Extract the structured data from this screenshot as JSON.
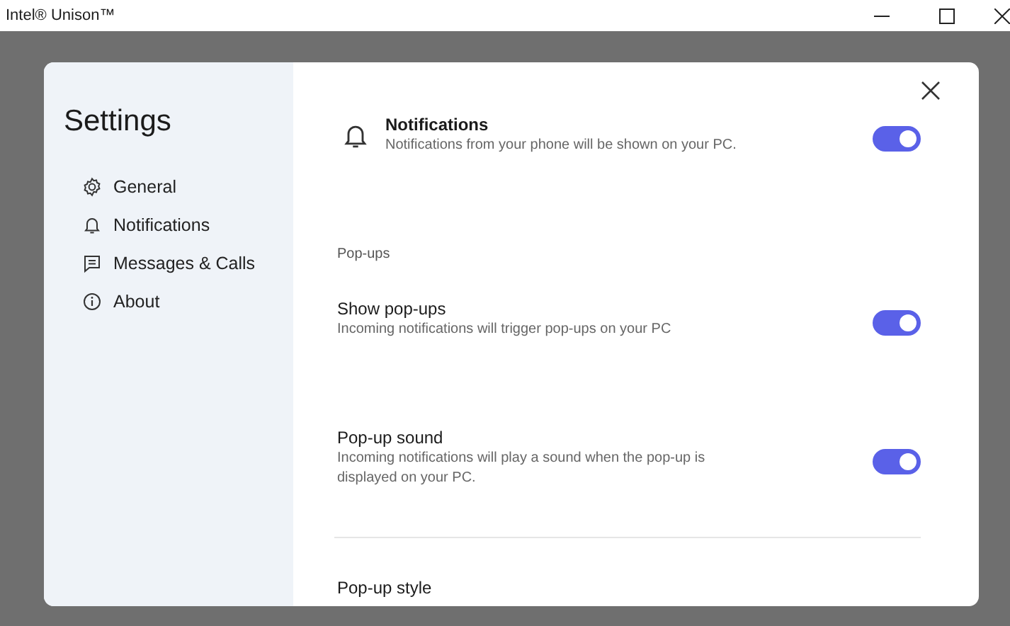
{
  "window": {
    "title": "Intel® Unison™"
  },
  "settings": {
    "title": "Settings",
    "nav": [
      {
        "label": "General"
      },
      {
        "label": "Notifications"
      },
      {
        "label": "Messages & Calls"
      },
      {
        "label": "About"
      }
    ],
    "items": [
      {
        "kind": "master",
        "title": "Notifications",
        "description": "Notifications from your phone will be shown on your PC.",
        "on": true
      },
      {
        "kind": "section",
        "title": "Pop-ups"
      },
      {
        "kind": "toggle",
        "title": "Show pop-ups",
        "description": "Incoming notifications will trigger pop-ups on your PC",
        "on": true
      },
      {
        "kind": "toggle",
        "title": "Pop-up sound",
        "description": "Incoming notifications will play a sound when the pop-up is displayed on your PC.",
        "on": true
      },
      {
        "kind": "divider"
      },
      {
        "kind": "heading",
        "title": "Pop-up style"
      }
    ]
  }
}
